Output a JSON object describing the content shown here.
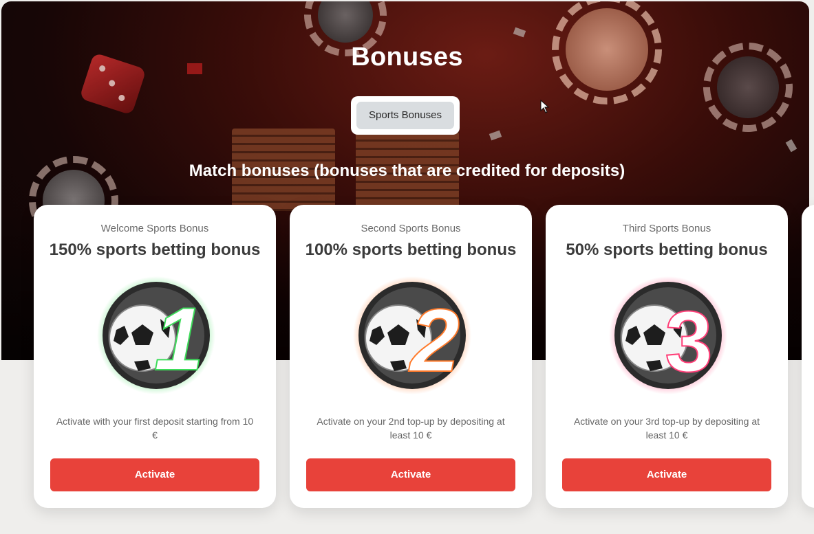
{
  "page": {
    "title": "Bonuses",
    "tab_label": "Sports Bonuses",
    "section_title": "Match bonuses (bonuses that are credited for deposits)"
  },
  "colors": {
    "accent_button": "#e8423a",
    "card_background": "#ffffff",
    "tab_active_background": "#d9dde0"
  },
  "cards": [
    {
      "kicker": "Welcome Sports Bonus",
      "headline": "150% sports betting bonus",
      "badge_number": "1",
      "badge_glow": "#3ddc5a",
      "description": "Activate with your first deposit starting from 10 €",
      "button_label": "Activate",
      "icon": "soccer-ball-badge-icon"
    },
    {
      "kicker": "Second Sports Bonus",
      "headline": "100% sports betting bonus",
      "badge_number": "2",
      "badge_glow": "#ff7a2a",
      "description": "Activate on your 2nd top-up by depositing at least 10 €",
      "button_label": "Activate",
      "icon": "soccer-ball-badge-icon"
    },
    {
      "kicker": "Third Sports Bonus",
      "headline": "50% sports betting bonus",
      "badge_number": "3",
      "badge_glow": "#ff3f78",
      "description": "Activate on your 3rd top-up by depositing at least 10 €",
      "button_label": "Activate",
      "icon": "soccer-ball-badge-icon"
    }
  ]
}
